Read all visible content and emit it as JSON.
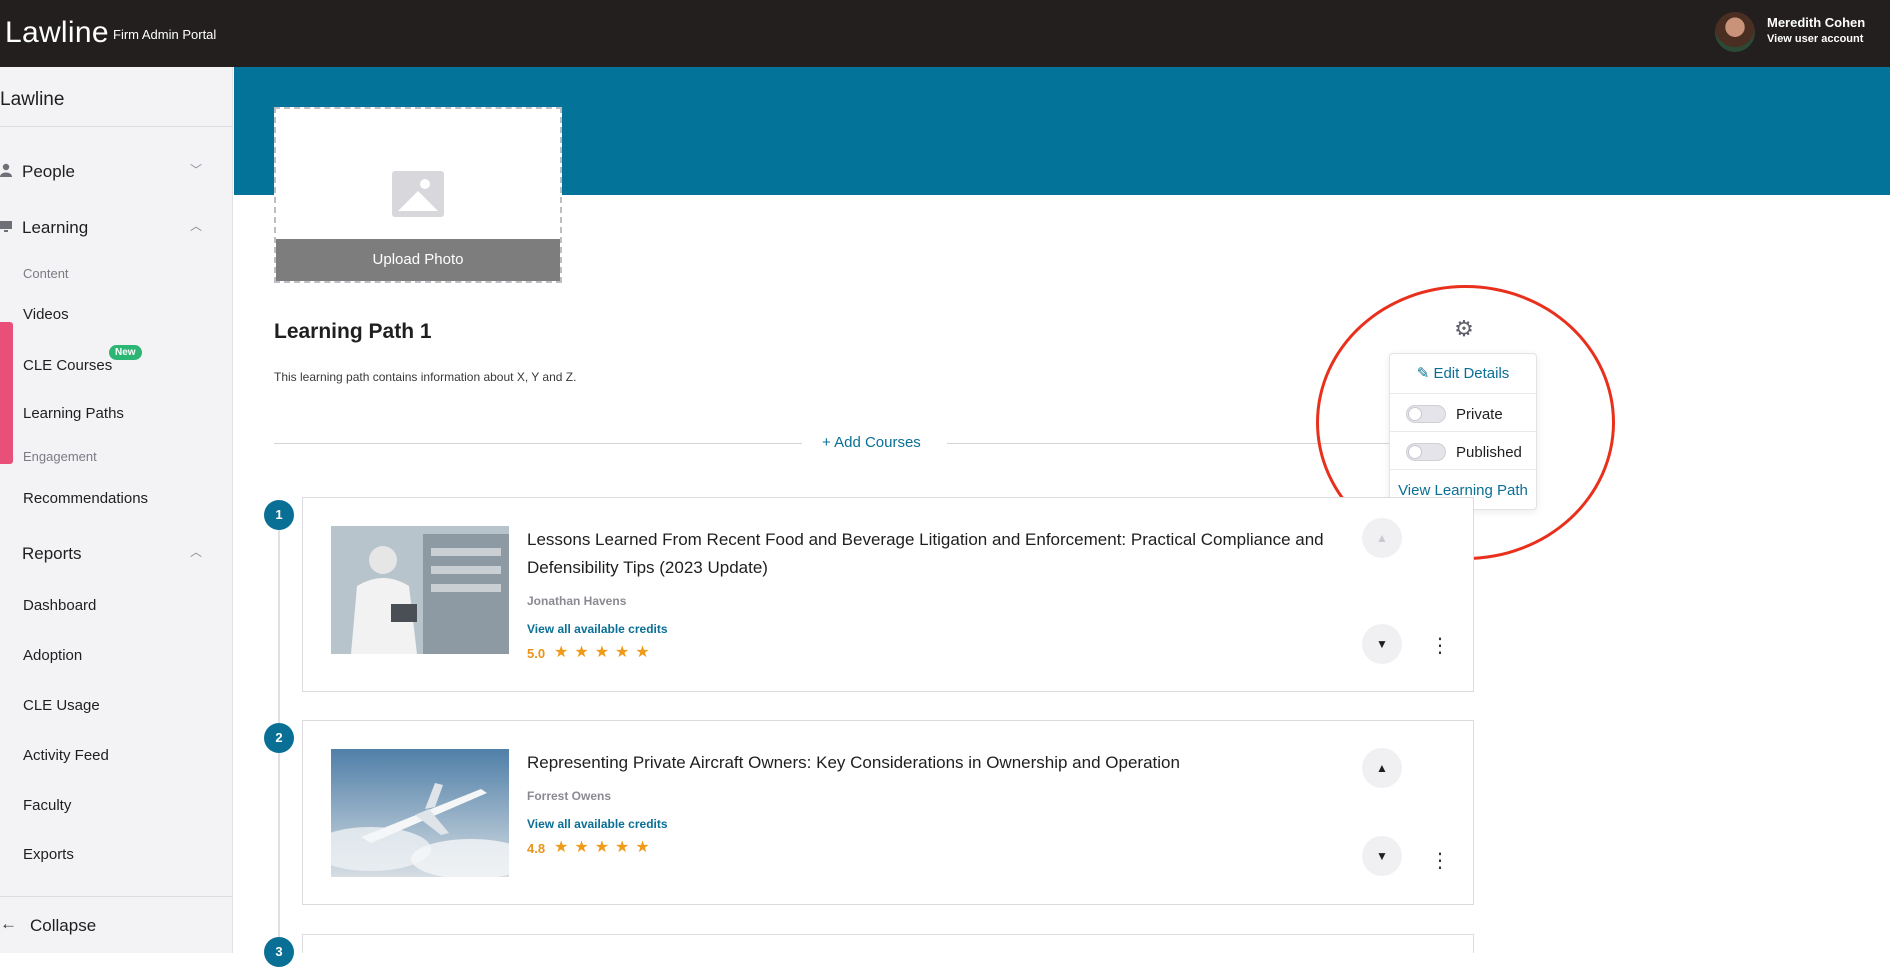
{
  "header": {
    "brand": "Lawline",
    "portal": "Firm Admin Portal",
    "user_name": "Meredith Cohen",
    "user_link": "View user account"
  },
  "sidebar": {
    "title": "Lawline",
    "people": "People",
    "learning": "Learning",
    "content_group": "Content",
    "videos": "Videos",
    "cle_courses": "CLE Courses",
    "new_badge": "New",
    "learning_paths": "Learning Paths",
    "engagement_group": "Engagement",
    "recommendations": "Recommendations",
    "reports": "Reports",
    "dashboard": "Dashboard",
    "adoption": "Adoption",
    "cle_usage": "CLE Usage",
    "activity_feed": "Activity Feed",
    "faculty": "Faculty",
    "exports": "Exports",
    "collapse": "Collapse"
  },
  "main": {
    "upload_photo": "Upload Photo",
    "title": "Learning Path 1",
    "description": "This learning path contains information about X, Y and Z.",
    "add_courses": "+ Add Courses"
  },
  "menu": {
    "edit_details": "Edit Details",
    "private": "Private",
    "published": "Published",
    "view_learning_path": "View Learning Path",
    "private_on": false,
    "published_on": false
  },
  "courses": [
    {
      "number": "1",
      "title": "Lessons Learned From Recent Food and Beverage Litigation and Enforcement: Practical Compliance and Defensibility Tips (2023 Update)",
      "author": "Jonathan Havens",
      "credits": "View all available credits",
      "rating": "5.0",
      "stars": "★★★★★"
    },
    {
      "number": "2",
      "title": "Representing Private Aircraft Owners: Key Considerations in Ownership and Operation",
      "author": "Forrest Owens",
      "credits": "View all available credits",
      "rating": "4.8",
      "stars": "★★★★★"
    },
    {
      "number": "3"
    }
  ],
  "colors": {
    "banner": "#037399",
    "accent_link": "#0a6f95",
    "topbar": "#231f1f",
    "star": "#f09a1a",
    "annotation": "#e8301c"
  }
}
